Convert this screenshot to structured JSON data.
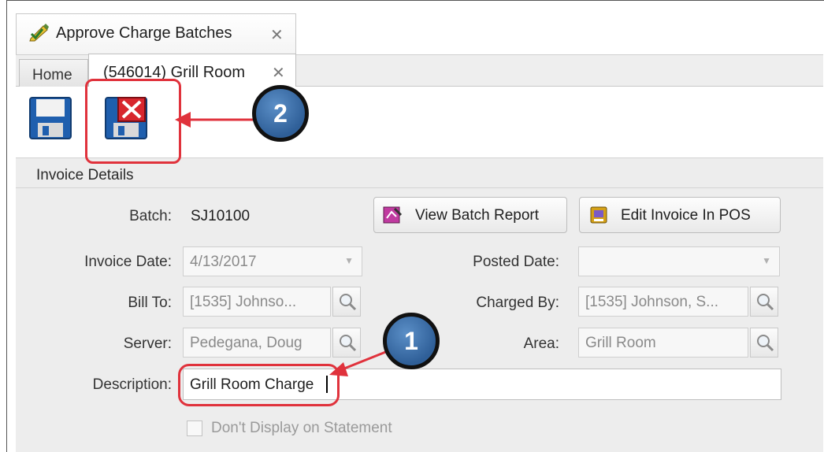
{
  "tabs": {
    "main_tab": {
      "label": "Approve Charge Batches",
      "close": "✕"
    },
    "home_tab": {
      "label": "Home"
    },
    "record_tab": {
      "label": "(546014) Grill Room",
      "close": "✕"
    }
  },
  "toolbar": {
    "save_icon": "floppy-save-icon",
    "cancel_icon": "floppy-cancel-icon"
  },
  "annotations": {
    "badge_1": "1",
    "badge_2": "2",
    "color": "#e0323c"
  },
  "section": {
    "title": "Invoice Details"
  },
  "form": {
    "batch": {
      "label": "Batch:",
      "value": "SJ10100"
    },
    "invoice_date": {
      "label": "Invoice Date:",
      "value": "4/13/2017"
    },
    "posted_date": {
      "label": "Posted Date:",
      "value": ""
    },
    "bill_to": {
      "label": "Bill To:",
      "value": "[1535] Johnso..."
    },
    "charged_by": {
      "label": "Charged By:",
      "value": "[1535] Johnson, S..."
    },
    "server": {
      "label": "Server:",
      "value": "Pedegana, Doug"
    },
    "area": {
      "label": "Area:",
      "value": "Grill Room"
    },
    "description": {
      "label": "Description:",
      "value": "Grill Room Charge"
    },
    "dont_display": {
      "label": "Don't Display on Statement",
      "checked": false
    }
  },
  "buttons": {
    "view_batch_report": "View Batch Report",
    "edit_invoice_pos": "Edit Invoice In POS"
  }
}
